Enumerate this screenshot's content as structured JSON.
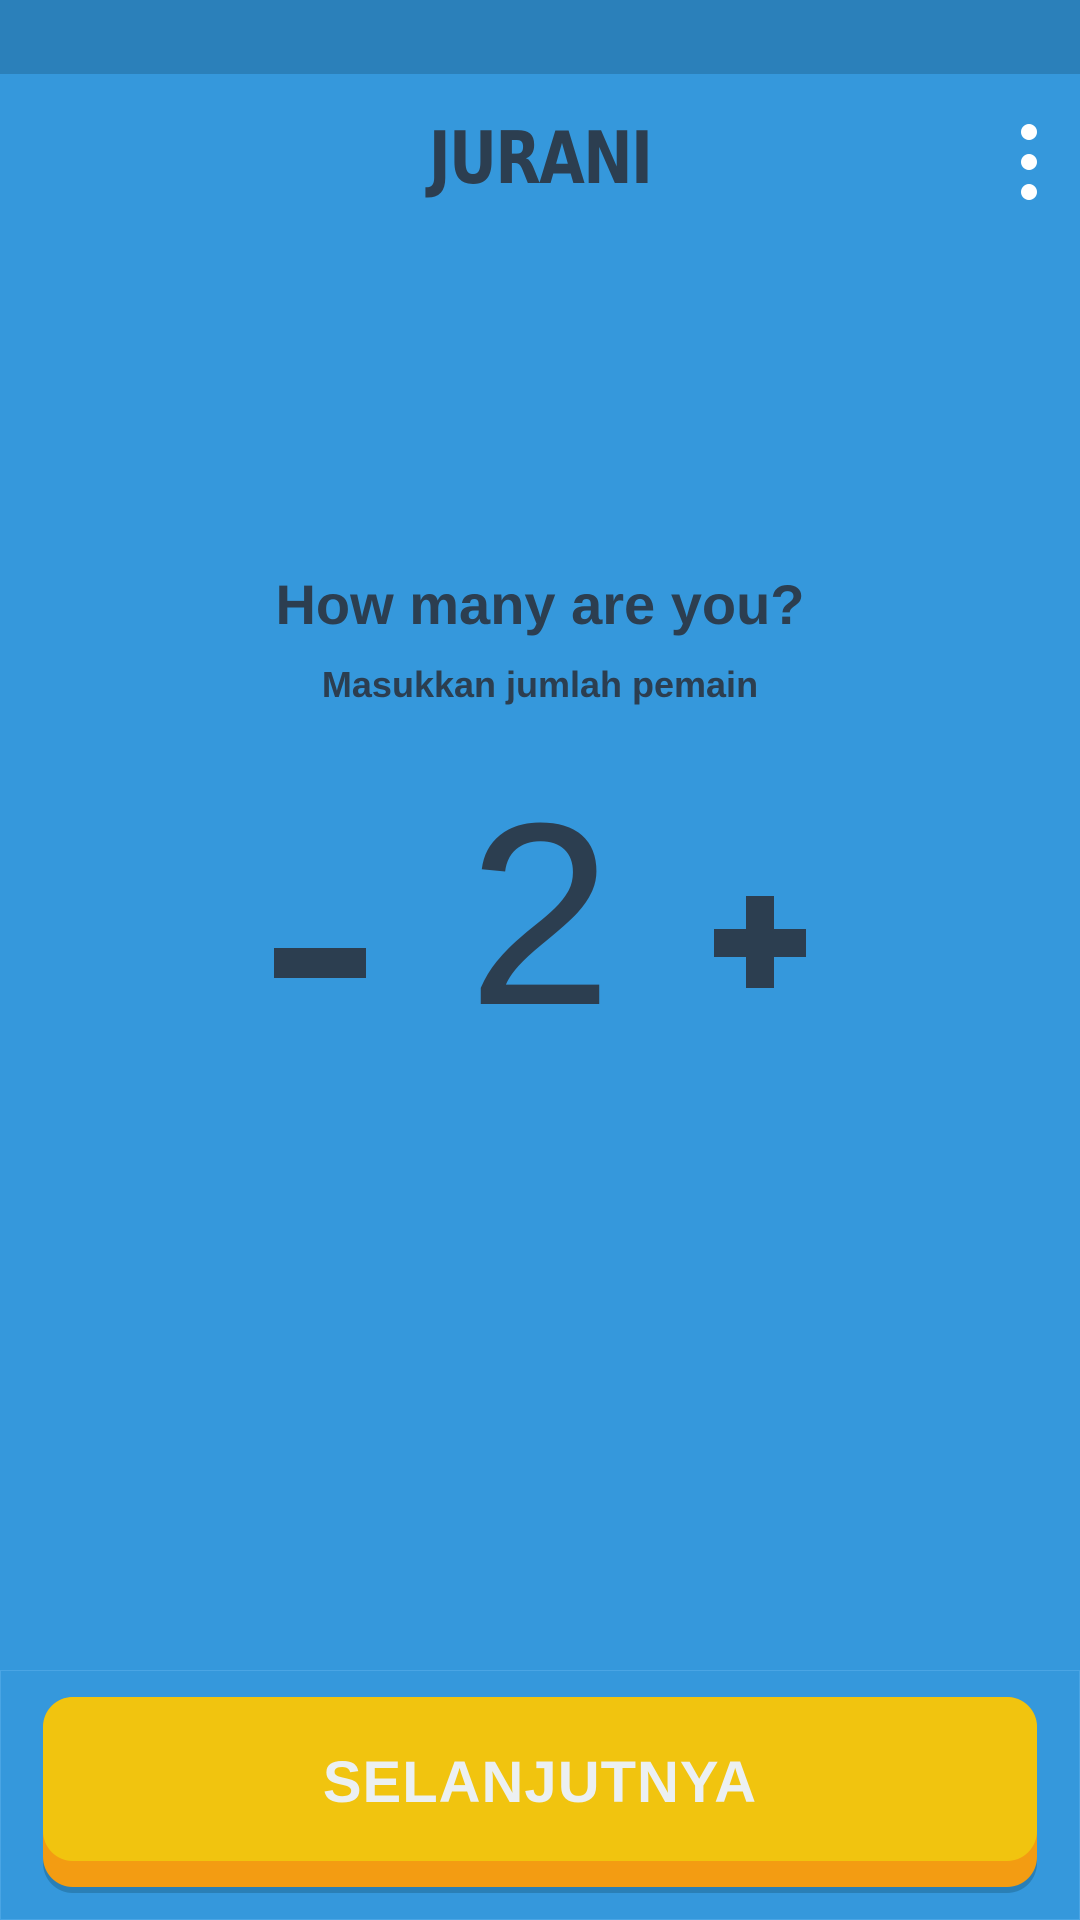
{
  "app": {
    "name": "JURANI"
  },
  "header": {
    "menu_icon": "more-vertical-icon"
  },
  "main": {
    "title": "How many are you?",
    "subtitle": "Masukkan jumlah pemain",
    "stepper": {
      "decrement_symbol": "−",
      "value": "2",
      "increment_symbol": "+"
    }
  },
  "footer": {
    "next_label": "SELANJUTNYA"
  },
  "colors": {
    "background": "#3598dc",
    "status_bar": "#2b80ba",
    "text": "#2c3e50",
    "button_face": "#f1c40f",
    "button_edge": "#f39c12",
    "button_text": "#ecf0f1"
  }
}
